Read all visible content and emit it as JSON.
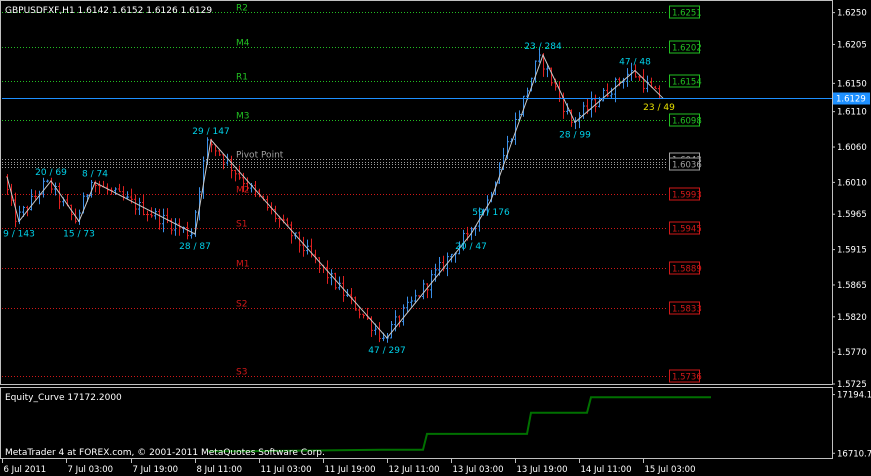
{
  "header": {
    "symbol_line": "GBPUSDFXF,H1  1.6142 1.6152 1.6126 1.6129",
    "equity_label": "Equity_Curve 17172.2000",
    "copyright": "MetaTrader 4 at FOREX.com, © 2001-2011 MetaQuotes Software Corp."
  },
  "colors": {
    "background": "#000000",
    "frame": "#c0c0c0",
    "bull": "#3a8fe8",
    "bear": "#e02020",
    "resistance": "#22c022",
    "support": "#d01818",
    "zigzag": "#c8c8c8",
    "zz_label": "#00d0e8",
    "current_price": "#1e90ff",
    "equity": "#007000",
    "pivot": "#a0a0a0",
    "ask_bid": "#e8e000"
  },
  "chart_data": [
    {
      "type": "candlestick",
      "title": "GBPUSDFXF,H1",
      "ohlc_header": {
        "open": 1.6142,
        "high": 1.6152,
        "low": 1.6126,
        "close": 1.6129
      },
      "ylim": [
        1.5725,
        1.6265
      ],
      "y_ticks": [
        "1.6250",
        "1.6205",
        "1.6150",
        "1.6110",
        "1.6060",
        "1.6010",
        "1.5965",
        "1.5915",
        "1.5865",
        "1.5820",
        "1.5770",
        "1.5725"
      ],
      "x_ticks": [
        "6 Jul 2011",
        "7 Jul 03:00",
        "7 Jul 19:00",
        "8 Jul 11:00",
        "11 Jul 03:00",
        "11 Jul 19:00",
        "12 Jul 11:00",
        "13 Jul 03:00",
        "13 Jul 19:00",
        "14 Jul 11:00",
        "15 Jul 03:00"
      ],
      "current_price": "1.6129",
      "zigzag": [
        {
          "bar": 0,
          "price": 1.6018
        },
        {
          "bar": 3,
          "price": 1.5955,
          "label": "9 / 143"
        },
        {
          "bar": 11,
          "price": 1.6012,
          "label": "20 / 69"
        },
        {
          "bar": 18,
          "price": 1.5955,
          "label": "15 / 73"
        },
        {
          "bar": 22,
          "price": 1.601,
          "label": "8 / 74"
        },
        {
          "bar": 47,
          "price": 1.5937,
          "label": "28 / 87"
        },
        {
          "bar": 51,
          "price": 1.607,
          "label": "29 / 147"
        },
        {
          "bar": 95,
          "price": 1.579,
          "label": "47 / 297"
        },
        {
          "bar": 116,
          "price": 1.5937,
          "label": "20 / 47"
        },
        {
          "bar": 121,
          "price": 1.5985,
          "label": "59 / 176"
        },
        {
          "bar": 134,
          "price": 1.619,
          "label": "23 / 284"
        },
        {
          "bar": 142,
          "price": 1.6095,
          "label": "28 / 99"
        },
        {
          "bar": 157,
          "price": 1.6168,
          "label": "47 / 48"
        },
        {
          "bar": 164,
          "price": 1.6129
        }
      ],
      "pivot_levels": [
        {
          "name": "R2",
          "price": 1.6251,
          "label": "1.6251",
          "kind": "resistance"
        },
        {
          "name": "M4",
          "price": 1.6202,
          "label": "1.6202",
          "kind": "resistance"
        },
        {
          "name": "R1",
          "price": 1.6154,
          "label": "1.6154",
          "kind": "resistance"
        },
        {
          "name": "M3",
          "price": 1.6098,
          "label": "1.6098",
          "kind": "resistance"
        },
        {
          "name": "Pivot Point",
          "price": 1.6043,
          "label": "1.6043",
          "kind": "pivot"
        },
        {
          "name": "",
          "price": 1.6036,
          "label": "1.6036",
          "kind": "pivot"
        },
        {
          "name": "M2",
          "price": 1.5993,
          "label": "1.5993",
          "kind": "support"
        },
        {
          "name": "S1",
          "price": 1.5945,
          "label": "1.5945",
          "kind": "support"
        },
        {
          "name": "M1",
          "price": 1.5889,
          "label": "1.5889",
          "kind": "support"
        },
        {
          "name": "S2",
          "price": 1.5833,
          "label": "1.5833",
          "kind": "support"
        },
        {
          "name": "S3",
          "price": 1.5736,
          "label": "1.5736",
          "kind": "support"
        }
      ],
      "last_annotation": "23 / 49"
    },
    {
      "type": "line",
      "title": "Equity_Curve 17172.2000",
      "ylim": [
        16680,
        17240
      ],
      "y_ticks": [
        "17194.1",
        "16710.75"
      ],
      "series": [
        {
          "name": "Equity_Curve",
          "points": [
            [
              50,
              16728
            ],
            [
              60,
              16728
            ],
            [
              95,
              16740
            ],
            [
              104,
              16740
            ],
            [
              105,
              16870
            ],
            [
              130,
              16870
            ],
            [
              131,
              17045
            ],
            [
              145,
              17045
            ],
            [
              146,
              17172
            ],
            [
              176,
              17172
            ]
          ]
        }
      ]
    }
  ]
}
